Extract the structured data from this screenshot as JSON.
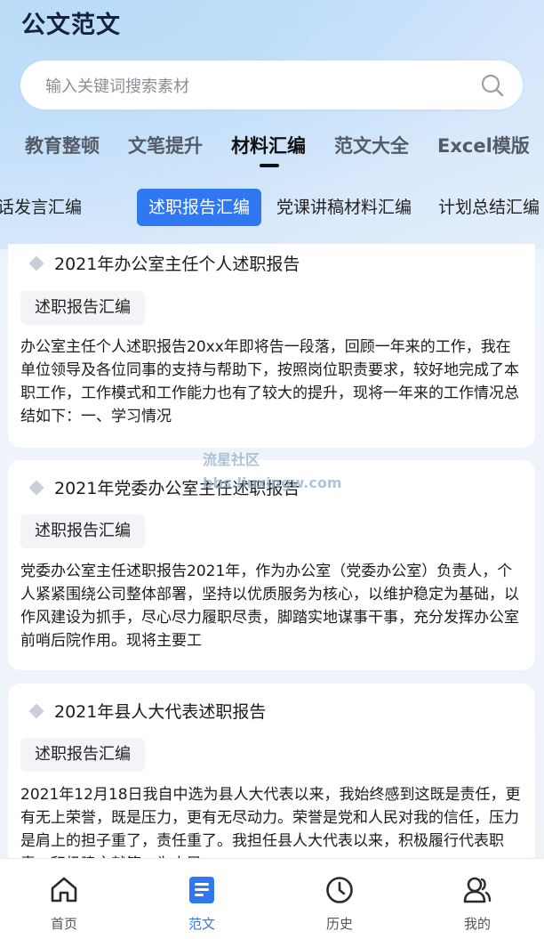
{
  "app": {
    "title": "公文范文"
  },
  "search": {
    "placeholder": "输入关键词搜索素材"
  },
  "tabs": [
    {
      "label": "教育整顿",
      "active": false
    },
    {
      "label": "文笔提升",
      "active": false
    },
    {
      "label": "材料汇编",
      "active": true
    },
    {
      "label": "范文大全",
      "active": false
    },
    {
      "label": "Excel模版",
      "active": false
    }
  ],
  "chips": [
    {
      "label": "讲话发言汇编",
      "active": false
    },
    {
      "label": "述职报告汇编",
      "active": true
    },
    {
      "label": "党课讲稿材料汇编",
      "active": false
    },
    {
      "label": "计划总结汇编",
      "active": false
    }
  ],
  "cards": [
    {
      "title": "2021年办公室主任个人述职报告",
      "tag": "述职报告汇编",
      "summary": "办公室主任个人述职报告20xx年即将告一段落，回顾一年来的工作，我在单位领导及各位同事的支持与帮助下，按照岗位职责要求，较好地完成了本职工作，工作模式和工作能力也有了较大的提升，现将一年来的工作情况总结如下：一、学习情况"
    },
    {
      "title": "2021年党委办公室主任述职报告",
      "tag": "述职报告汇编",
      "summary": "党委办公室主任述职报告2021年，作为办公室（党委办公室）负责人，个人紧紧围绕公司整体部署，坚持以优质服务为核心，以维护稳定为基础，以作风建设为抓手，尽心尽力履职尽责，脚踏实地谋事干事，充分发挥办公室前哨后院作用。现将主要工"
    },
    {
      "title": "2021年县人大代表述职报告",
      "tag": "述职报告汇编",
      "summary": "2021年12月18日我自中选为县人大代表以来，我始终感到这既是责任，更有无上荣誉，既是压力，更有无尽动力。荣誉是党和人民对我的信任，压力是肩上的担子重了，责任重了。我担任县人大代表以来，积极履行代表职责，积极建言献策，为人民"
    }
  ],
  "watermark": {
    "line1": "流星社区",
    "line2": "bbs.liuxingw.com"
  },
  "bottom_nav": [
    {
      "label": "首页",
      "icon": "home-icon",
      "active": false
    },
    {
      "label": "范文",
      "icon": "document-icon",
      "active": true
    },
    {
      "label": "历史",
      "icon": "clock-icon",
      "active": false
    },
    {
      "label": "我的",
      "icon": "users-icon",
      "active": false
    }
  ],
  "colors": {
    "accent": "#2f78f1",
    "title": "#16223c",
    "card_bg": "#ffffff"
  }
}
